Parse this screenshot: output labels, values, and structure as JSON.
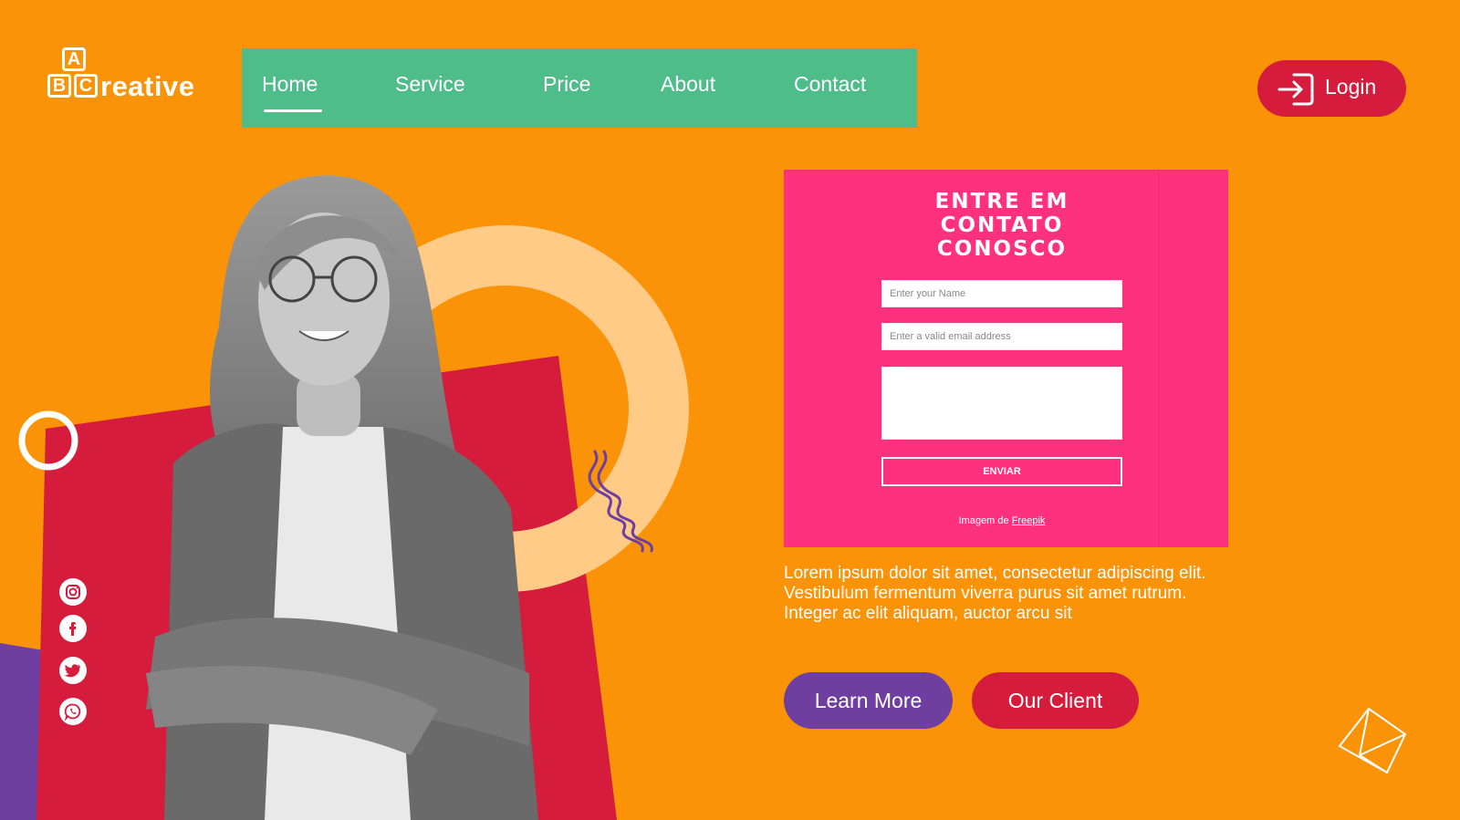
{
  "brand": {
    "logo_letters": [
      "A",
      "B",
      "C"
    ],
    "logo_text": "reative"
  },
  "nav": {
    "items": [
      {
        "label": "Home",
        "active": true
      },
      {
        "label": "Service"
      },
      {
        "label": "Price"
      },
      {
        "label": "About"
      },
      {
        "label": "Contact"
      }
    ]
  },
  "login": {
    "label": "Login",
    "icon": "login-icon"
  },
  "contact_card": {
    "title_lines": [
      "ENTRE EM",
      "CONTATO",
      "CONOSCO"
    ],
    "name_placeholder": "Enter your Name",
    "email_placeholder": "Enter a valid email address",
    "submit_label": "ENVIAR",
    "credit_prefix": "Imagem de",
    "credit_link": "Freepik"
  },
  "description": "Lorem ipsum dolor sit amet, consectetur adipiscing elit. Vestibulum fermentum viverra purus sit amet rutrum. Integer ac elit aliquam, auctor arcu sit",
  "buttons": {
    "learn_more": "Learn More",
    "our_client": "Our Client"
  },
  "social": [
    "instagram-icon",
    "facebook-icon",
    "twitter-icon",
    "whatsapp-icon"
  ],
  "colors": {
    "background": "#fa9307",
    "nav": "#4fbd8a",
    "accent_red": "#d51c3c",
    "accent_purple": "#6e3ea1",
    "card_pink": "#fd317e",
    "ring": "#ffcb86"
  }
}
